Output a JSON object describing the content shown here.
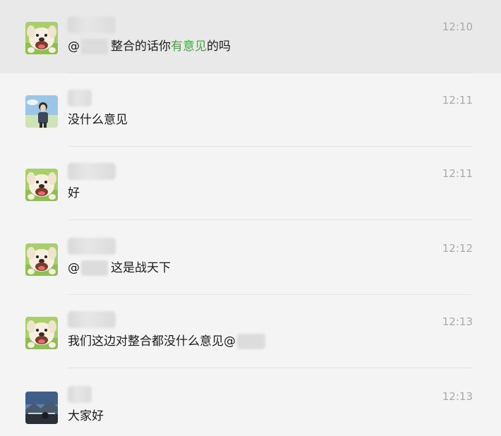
{
  "messages": [
    {
      "time": "12:10",
      "at": "@",
      "text": "整合的话你",
      "highlight": "有意见",
      "text_after": "的吗",
      "avatar": "cartoon-dog-avatar"
    },
    {
      "time": "12:11",
      "text": "没什么意见",
      "avatar": "person-photo-avatar"
    },
    {
      "time": "12:11",
      "text": "好",
      "avatar": "cartoon-dog-avatar"
    },
    {
      "time": "12:12",
      "at": "@",
      "text": "这是战天下",
      "avatar": "cartoon-dog-avatar"
    },
    {
      "time": "12:13",
      "text": "我们这边对整合都没什么意见@",
      "avatar": "cartoon-dog-avatar"
    },
    {
      "time": "12:13",
      "text": "大家好",
      "avatar": "landscape-photo-avatar"
    }
  ],
  "colors": {
    "highlight": "#3daa3a",
    "time": "#a9a9a9",
    "selected_bg": "#e9e9e9"
  }
}
